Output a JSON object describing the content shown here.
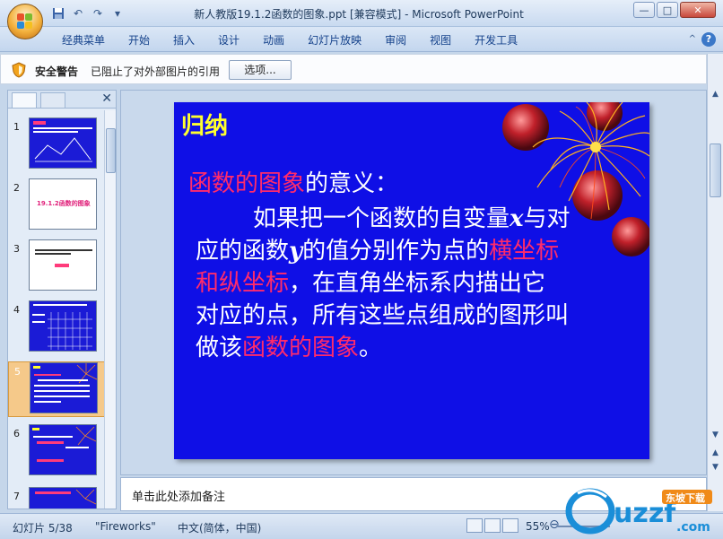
{
  "window": {
    "title": "新人教版19.1.2函数的图象.ppt [兼容模式] - Microsoft PowerPoint",
    "controls": {
      "minimize": "—",
      "maximize": "□",
      "close": "✕"
    }
  },
  "quick_access": {
    "save_icon": "save-icon",
    "undo_icon": "undo-icon",
    "redo_icon": "redo-icon",
    "customize": "▾"
  },
  "ribbon": {
    "tabs": [
      "经典菜单",
      "开始",
      "插入",
      "设计",
      "动画",
      "幻灯片放映",
      "审阅",
      "视图",
      "开发工具"
    ],
    "help": "?",
    "minimize": "^"
  },
  "security_bar": {
    "title": "安全警告",
    "message": "已阻止了对外部图片的引用",
    "options_label": "选项...",
    "close": "x"
  },
  "left_panel": {
    "close": "✕",
    "slides": [
      {
        "number": "1"
      },
      {
        "number": "2",
        "caption": "19.1.2函数的图象"
      },
      {
        "number": "3"
      },
      {
        "number": "4"
      },
      {
        "number": "5"
      },
      {
        "number": "6"
      },
      {
        "number": "7"
      }
    ],
    "selected": 5
  },
  "slide": {
    "title": "归纳",
    "line1_pink": "函数的图象",
    "line1_rest": "的意义：",
    "body": [
      {
        "text": "如果把一个函数的自变量",
        "var": "x",
        "rest": "与对"
      },
      {
        "a": "应的函数",
        "var": "y",
        "b": "的值分别作为点的",
        "pink": "横坐标"
      },
      {
        "pink": "和纵坐标",
        "rest": "，在直角坐标系内描出它"
      },
      {
        "text": "对应的点，所有这些点组成的图形叫"
      },
      {
        "a": "做该",
        "pink": "函数的图象",
        "b": "。"
      }
    ]
  },
  "notes": {
    "placeholder": "单击此处添加备注"
  },
  "status": {
    "slide_info": "幻灯片 5/38",
    "theme": "\"Fireworks\"",
    "language": "中文(简体，中国)",
    "zoom": "55%"
  },
  "colors": {
    "slide_bg": "#0f0fe6",
    "title_yellow": "#ffff2e",
    "highlight_pink": "#ff2b6b"
  }
}
